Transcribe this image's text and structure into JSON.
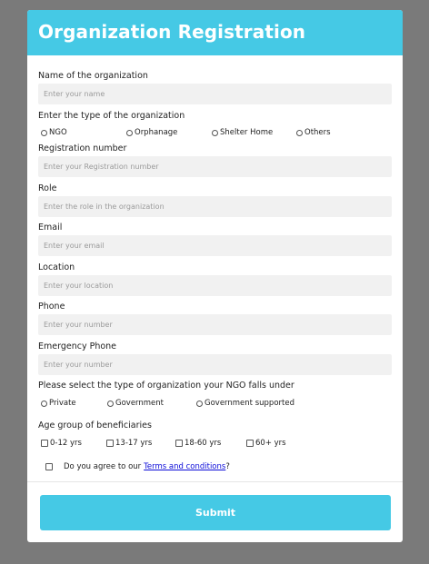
{
  "header": {
    "title": "Organization Registration"
  },
  "fields": {
    "name": {
      "label": "Name of the organization",
      "placeholder": "Enter your name"
    },
    "type": {
      "label": "Enter the type of the organization",
      "options": [
        "NGO",
        "Orphanage",
        "Shelter Home",
        "Others"
      ]
    },
    "registration": {
      "label": "Registration number",
      "placeholder": "Enter your Registration number"
    },
    "role": {
      "label": "Role",
      "placeholder": "Enter the role in the organization"
    },
    "email": {
      "label": "Email",
      "placeholder": "Enter your email"
    },
    "location": {
      "label": "Location",
      "placeholder": "Enter your location"
    },
    "phone": {
      "label": "Phone",
      "placeholder": "Enter your number"
    },
    "emergency_phone": {
      "label": "Emergency Phone",
      "placeholder": "Enter your number"
    },
    "category": {
      "label": "Please select the type of organization your NGO falls under",
      "options": [
        "Private",
        "Government",
        "Government supported"
      ]
    },
    "age_group": {
      "label": "Age group of beneficiaries",
      "options": [
        "0-12 yrs",
        "13-17 yrs",
        "18-60 yrs",
        "60+ yrs"
      ]
    }
  },
  "agreement": {
    "text": "Do you agree to our",
    "link": "Terms and conditions",
    "suffix": "?"
  },
  "submit": {
    "label": "Submit"
  },
  "colors": {
    "accent": "#45c9e5",
    "backdrop": "#7a7a7a",
    "link": "#0a0ad8"
  }
}
